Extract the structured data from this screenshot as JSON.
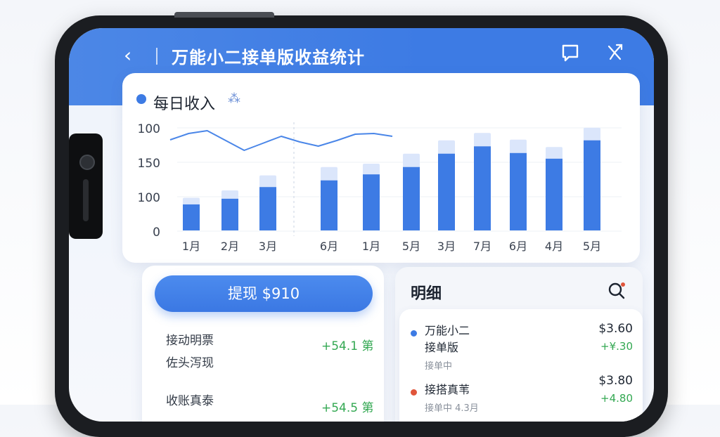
{
  "header": {
    "title": "万能小二接单版收益统计",
    "back_glyph": "‹"
  },
  "chart_card": {
    "title": "每日收入",
    "sparkle": "⁂"
  },
  "chart_data": {
    "type": "bar",
    "categories": [
      "1月",
      "2月",
      "3月",
      "6月",
      "1月",
      "5月",
      "3月",
      "7月",
      "6月",
      "4月",
      "5月"
    ],
    "series": [
      {
        "values": [
          78,
          95,
          130,
          150,
          168,
          190,
          230,
          252,
          232,
          215,
          270
        ]
      },
      {
        "values": [
          98,
          120,
          165,
          190,
          200,
          230,
          270,
          292,
          272,
          250,
          308
        ]
      }
    ],
    "yticks": [
      "100",
      "150",
      "100",
      "0"
    ],
    "line": [
      95,
      86,
      82,
      96,
      110,
      100,
      90,
      98,
      104,
      96,
      87,
      86,
      90
    ],
    "colors": {
      "bar": "#3d7be4",
      "bar_light": "#dbe6fb",
      "line": "#4a86e8"
    }
  },
  "withdraw": {
    "button_label": "提现 $910",
    "rows": [
      {
        "label": "接动明票",
        "value": "+54.1 第"
      },
      {
        "label": "佐头泻现",
        "value": ""
      },
      {
        "label": "收账真泰",
        "value": "+54.5 第"
      }
    ]
  },
  "detail": {
    "title": "明细",
    "items": [
      {
        "name_line1": "万能小二",
        "name_line2": "接单版",
        "sub": "接单中",
        "amount": "$3.60",
        "gain": "+¥.30",
        "dot_color": "#3d7be4"
      },
      {
        "name_line1": "接搭真苇",
        "name_line2": "",
        "sub": "接单中 4.3月",
        "amount": "$3.80",
        "gain": "+4.80",
        "dot_color": "#e0553b"
      }
    ]
  }
}
